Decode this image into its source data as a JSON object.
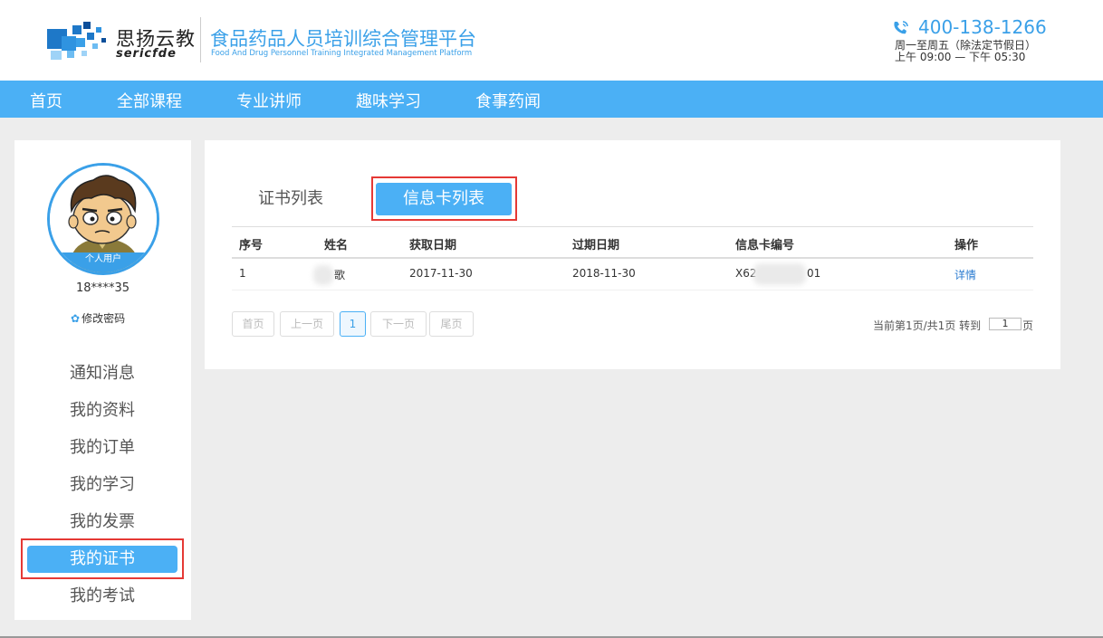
{
  "header": {
    "logo_cn": "思扬云教",
    "logo_en": "sericfde",
    "platform_title": "食品药品人员培训综合管理平台",
    "platform_subtitle": "Food And Drug Personnel Training Integrated Management Platform",
    "phone": "400-138-1266",
    "hours_line1": "周一至周五（除法定节假日）",
    "hours_line2": "上午 09:00 — 下午 05:30",
    "colors": {
      "brand": "#3aa0e8",
      "nav": "#4bb0f5"
    }
  },
  "nav": {
    "items": [
      {
        "label": "首页"
      },
      {
        "label": "全部课程"
      },
      {
        "label": "专业讲师"
      },
      {
        "label": "趣味学习"
      },
      {
        "label": "食事药闻"
      }
    ]
  },
  "sidebar": {
    "avatar_badge": "个人用户",
    "username": "18****35",
    "change_password": "修改密码",
    "menu": [
      {
        "label": "通知消息"
      },
      {
        "label": "我的资料"
      },
      {
        "label": "我的订单"
      },
      {
        "label": "我的学习"
      },
      {
        "label": "我的发票"
      },
      {
        "label": "我的证书"
      },
      {
        "label": "我的考试"
      }
    ],
    "active_index": 5
  },
  "content": {
    "tabs": [
      {
        "label": "证书列表"
      },
      {
        "label": "信息卡列表"
      }
    ],
    "active_tab": 1,
    "table": {
      "headers": [
        "序号",
        "姓名",
        "获取日期",
        "过期日期",
        "信息卡编号",
        "操作"
      ],
      "rows": [
        {
          "index": "1",
          "name": "歌",
          "obtained": "2017-11-30",
          "expires": "2018-11-30",
          "card_prefix": "X62",
          "card_suffix": "01",
          "action": "详情"
        }
      ]
    },
    "pager": {
      "first": "首页",
      "prev": "上一页",
      "current": "1",
      "next": "下一页",
      "last": "尾页",
      "info": "当前第1页/共1页 转到",
      "goto_value": "1",
      "page_unit": "页"
    }
  }
}
